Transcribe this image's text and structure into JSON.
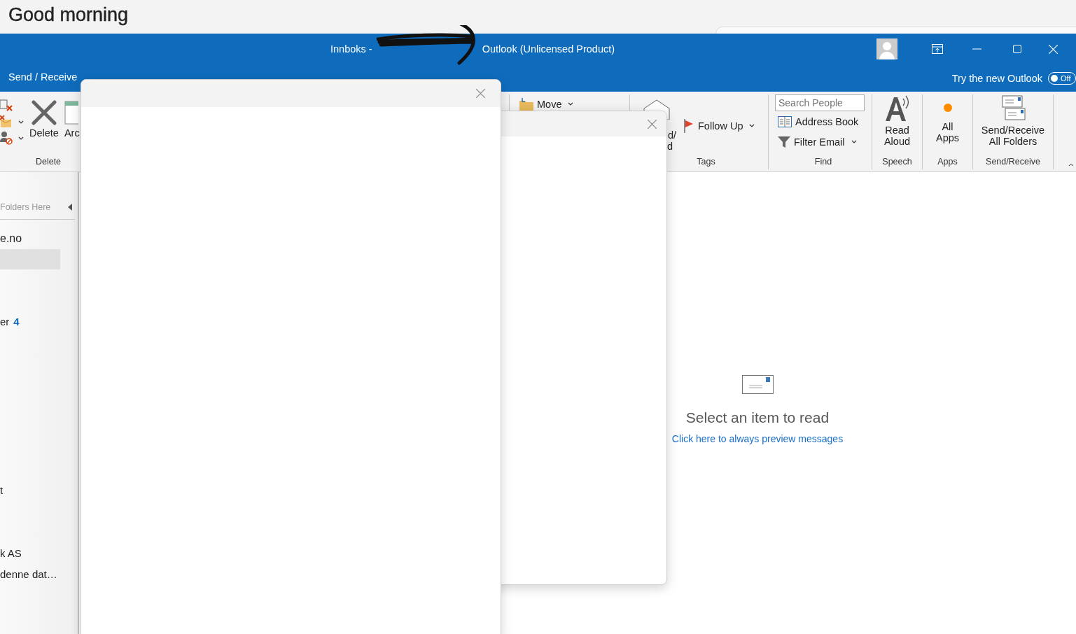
{
  "greeting": "Good morning",
  "window": {
    "title_prefix": "Innboks -",
    "title": "Outlook (Unlicensed Product)",
    "try_new": {
      "label": "Try the new Outlook",
      "on": false,
      "state_label": "Off"
    }
  },
  "tabs": [
    {
      "label": "Send / Receive",
      "selected": false
    }
  ],
  "ribbon": {
    "delete_group": {
      "buttons": [
        "Delete",
        "Arc"
      ],
      "label": "Delete"
    },
    "move": "Move",
    "respond_fragments": [
      "d/",
      "d"
    ],
    "follow_up": "Follow Up",
    "tags_label": "Tags",
    "find": {
      "search": {
        "placeholder": "Search People"
      },
      "address_book": "Address Book",
      "filter_email": "Filter Email",
      "label": "Find"
    },
    "speech": {
      "button": "Read Aloud",
      "label": "Speech"
    },
    "apps": {
      "button": "All Apps",
      "label": "Apps"
    },
    "send_receive": {
      "button": "Send/Receive All Folders",
      "label": "Send/Receive"
    }
  },
  "folder_pane": {
    "header": "Folders Here",
    "items": [
      {
        "kind": "account",
        "label": "e.no",
        "selected": false
      },
      {
        "kind": "folder",
        "selected": true
      },
      {
        "kind": "folder",
        "label": "er",
        "count": "4",
        "selected": false
      },
      {
        "kind": "folder",
        "label": "t",
        "selected": false
      },
      {
        "kind": "folder",
        "label": "k AS",
        "selected": false
      },
      {
        "kind": "folder",
        "label": "denne dat…",
        "selected": false
      }
    ]
  },
  "reading_pane": {
    "message": "Select an item to read",
    "link": "Click here to always preview messages"
  }
}
